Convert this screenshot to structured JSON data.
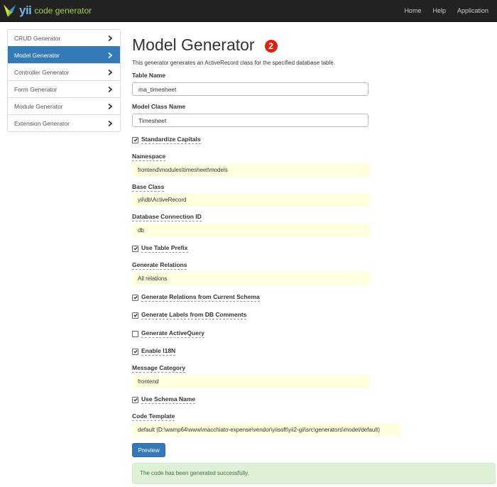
{
  "navbar": {
    "brand_yii": "yii",
    "brand_rest": "code generator",
    "links": [
      "Home",
      "Help",
      "Application"
    ]
  },
  "sidebar": {
    "items": [
      {
        "label": "CRUD Generator",
        "active": false
      },
      {
        "label": "Model Generator",
        "active": true
      },
      {
        "label": "Controller Generator",
        "active": false
      },
      {
        "label": "Form Generator",
        "active": false
      },
      {
        "label": "Module Generator",
        "active": false
      },
      {
        "label": "Extension Generator",
        "active": false
      }
    ]
  },
  "page": {
    "title": "Model Generator",
    "badge": "2",
    "description": "This generator generates an ActiveRecord class for the specified database table."
  },
  "form": {
    "table_name": {
      "label": "Table Name",
      "value": "ma_timesheet"
    },
    "model_class": {
      "label": "Model Class Name",
      "value": "Timesheet"
    },
    "standardize_capitals": {
      "label": "Standardize Capitals",
      "checked": true
    },
    "namespace": {
      "label": "Namespace",
      "value": "frontend\\modules\\timesheet\\models"
    },
    "base_class": {
      "label": "Base Class",
      "value": "yii\\db\\ActiveRecord"
    },
    "db_connection": {
      "label": "Database Connection ID",
      "value": "db"
    },
    "use_table_prefix": {
      "label": "Use Table Prefix",
      "checked": true
    },
    "generate_relations": {
      "label": "Generate Relations",
      "value": "All relations"
    },
    "relations_from_schema": {
      "label": "Generate Relations from Current Schema",
      "checked": true
    },
    "labels_from_comments": {
      "label": "Generate Labels from DB Comments",
      "checked": true
    },
    "generate_activequery": {
      "label": "Generate ActiveQuery",
      "checked": false
    },
    "enable_i18n": {
      "label": "Enable I18N",
      "checked": true
    },
    "message_category": {
      "label": "Message Category",
      "value": "frontend"
    },
    "use_schema_name": {
      "label": "Use Schema Name",
      "checked": true
    },
    "code_template": {
      "label": "Code Template",
      "value": "default (D:\\wamp64\\www\\macchiato-expense\\vendor\\yiisoft\\yii2-gii\\src\\generators\\model/default)"
    }
  },
  "buttons": {
    "preview": "Preview"
  },
  "alert": {
    "success": "The code has been generated successfully."
  },
  "colors": {
    "primary": "#337ab7",
    "navbar": "#222222",
    "sticky": "#ffffe0",
    "success_bg": "#dff0d8",
    "badge": "#d9230f"
  }
}
